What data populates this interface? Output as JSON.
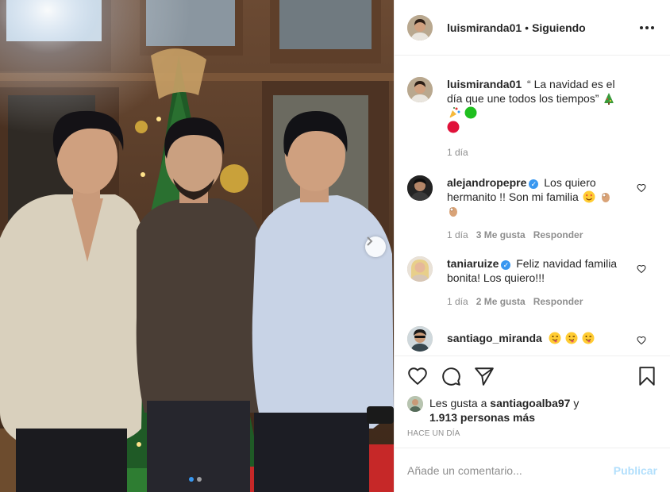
{
  "post": {
    "author": "luismiranda01",
    "separator": "•",
    "follow_status": "Siguiendo",
    "more_icon": "more-horizontal-icon"
  },
  "photo": {
    "alt_subject": "three men in front of a Christmas tree",
    "next_icon": "chevron-right-icon",
    "carousel_count": 2,
    "carousel_active": 0
  },
  "caption": {
    "user": "luismiranda01",
    "text": "“ La navidad es el día que une todos los tiempos”",
    "emojis": [
      "christmas-tree-emoji",
      "party-popper-emoji",
      "green-circle-emoji",
      "red-circle-emoji"
    ],
    "time": "1 día"
  },
  "comments": [
    {
      "user": "alejandropepre",
      "verified": true,
      "text": "Los quiero hermanito !! Son mi familia",
      "emojis": [
        "heart-eyes-emoji",
        "ok-hand-emoji",
        "ok-hand-emoji"
      ],
      "time": "1 día",
      "likes": "3 Me gusta",
      "reply": "Responder"
    },
    {
      "user": "taniaruize",
      "verified": true,
      "text": "Feliz navidad familia bonita! Los quiero!!!",
      "time": "1 día",
      "likes": "2 Me gusta",
      "reply": "Responder"
    },
    {
      "user": "santiago_miranda",
      "verified": false,
      "text": "",
      "emojis": [
        "tongue-wink-emoji",
        "tongue-wink-emoji",
        "tongue-wink-emoji"
      ]
    }
  ],
  "actions": {
    "like_icon": "heart-icon",
    "comment_icon": "comment-icon",
    "share_icon": "paper-plane-icon",
    "save_icon": "bookmark-icon"
  },
  "likes": {
    "prefix": "Les gusta a",
    "user": "santiagoalba97",
    "conj": "y",
    "others": "1.913 personas más"
  },
  "timestamp": "HACE UN DÍA",
  "add_comment": {
    "placeholder": "Añade un comentario...",
    "publish": "Publicar"
  },
  "colors": {
    "link_blue": "#3897f0",
    "publish_disabled": "#b2dffc",
    "muted": "#8e8e8e",
    "text": "#262626",
    "border": "#efefef"
  }
}
